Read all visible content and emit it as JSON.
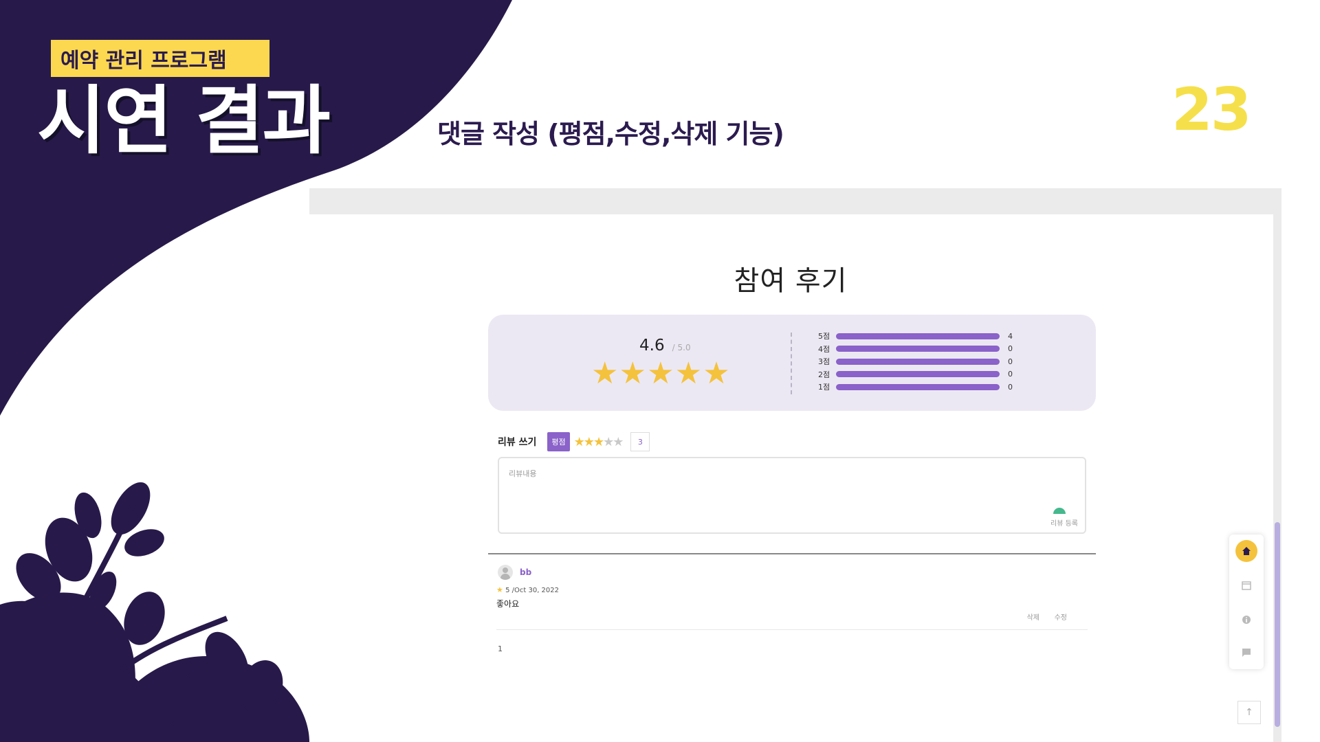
{
  "slide": {
    "tag": "예약 관리 프로그램",
    "title": "시연 결과",
    "subtitle": "댓글 작성 (평점,수정,삭제 기능)",
    "page_number": "23"
  },
  "reviews_page": {
    "title": "참여 후기",
    "summary": {
      "average": "4.6",
      "max": "/ 5.0",
      "stars_filled": 5,
      "distribution": [
        {
          "label": "5점",
          "count": "4"
        },
        {
          "label": "4점",
          "count": "0"
        },
        {
          "label": "3점",
          "count": "0"
        },
        {
          "label": "2점",
          "count": "0"
        },
        {
          "label": "1점",
          "count": "0"
        }
      ]
    },
    "write": {
      "label": "리뷰 쓰기",
      "rating_chip": "평점",
      "selected_rating": 3,
      "rating_value": "3",
      "textarea_placeholder": "리뷰내용",
      "submit_label": "리뷰 등록"
    },
    "review_list": [
      {
        "name": "bb",
        "rating": "5",
        "date": "/Oct 30, 2022",
        "content": "좋아요",
        "delete_label": "삭제",
        "edit_label": "수정"
      }
    ],
    "pagination": "1"
  },
  "colors": {
    "accent_purple": "#8a62c9",
    "star_yellow": "#f4c23c",
    "slide_dark": "#271a4a",
    "tag_yellow": "#fbd84f"
  },
  "icons": {
    "fab": [
      "home-icon",
      "calendar-icon",
      "info-icon",
      "chat-icon"
    ],
    "scroll_top": "arrow-up-icon"
  }
}
